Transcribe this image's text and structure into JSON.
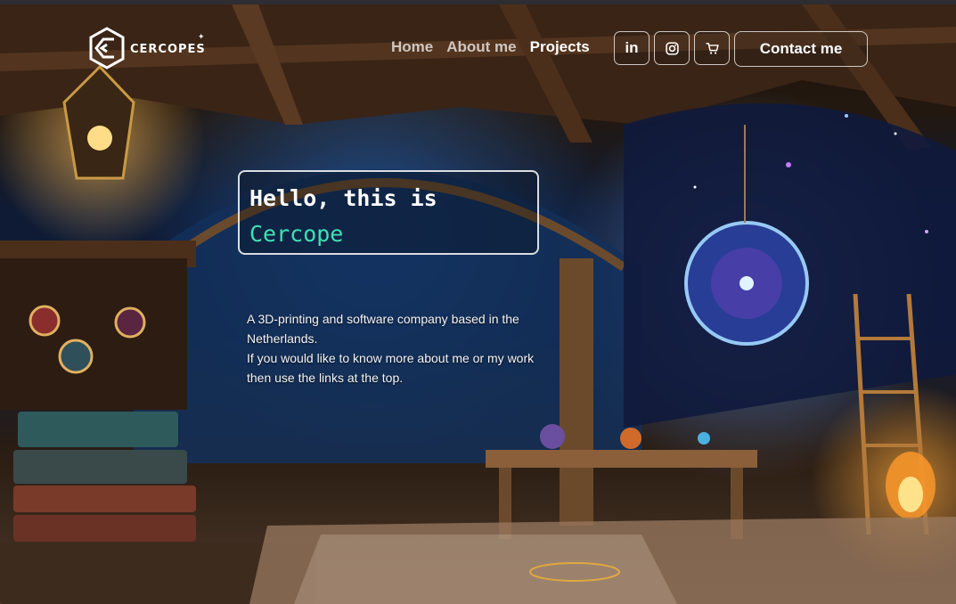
{
  "brand": {
    "name": "CERCOPES",
    "logo_icon": "cercopes-logo-icon"
  },
  "nav": {
    "links": [
      {
        "label": "Home",
        "active": false
      },
      {
        "label": "About me",
        "active": false
      },
      {
        "label": "Projects",
        "active": true
      }
    ]
  },
  "social": [
    {
      "label": "in",
      "icon": "linkedin-icon"
    },
    {
      "label": "",
      "icon": "instagram-icon"
    },
    {
      "label": "",
      "icon": "cart-icon"
    }
  ],
  "header": {
    "contact_label": "Contact me"
  },
  "hero": {
    "greeting": "Hello, this is",
    "name": "Cercope",
    "name_color": "#3fe0b5",
    "description_lines": [
      "A 3D-printing and software company based in the Netherlands.",
      "If you would like to know more about me or my work then use the links at the top."
    ]
  }
}
